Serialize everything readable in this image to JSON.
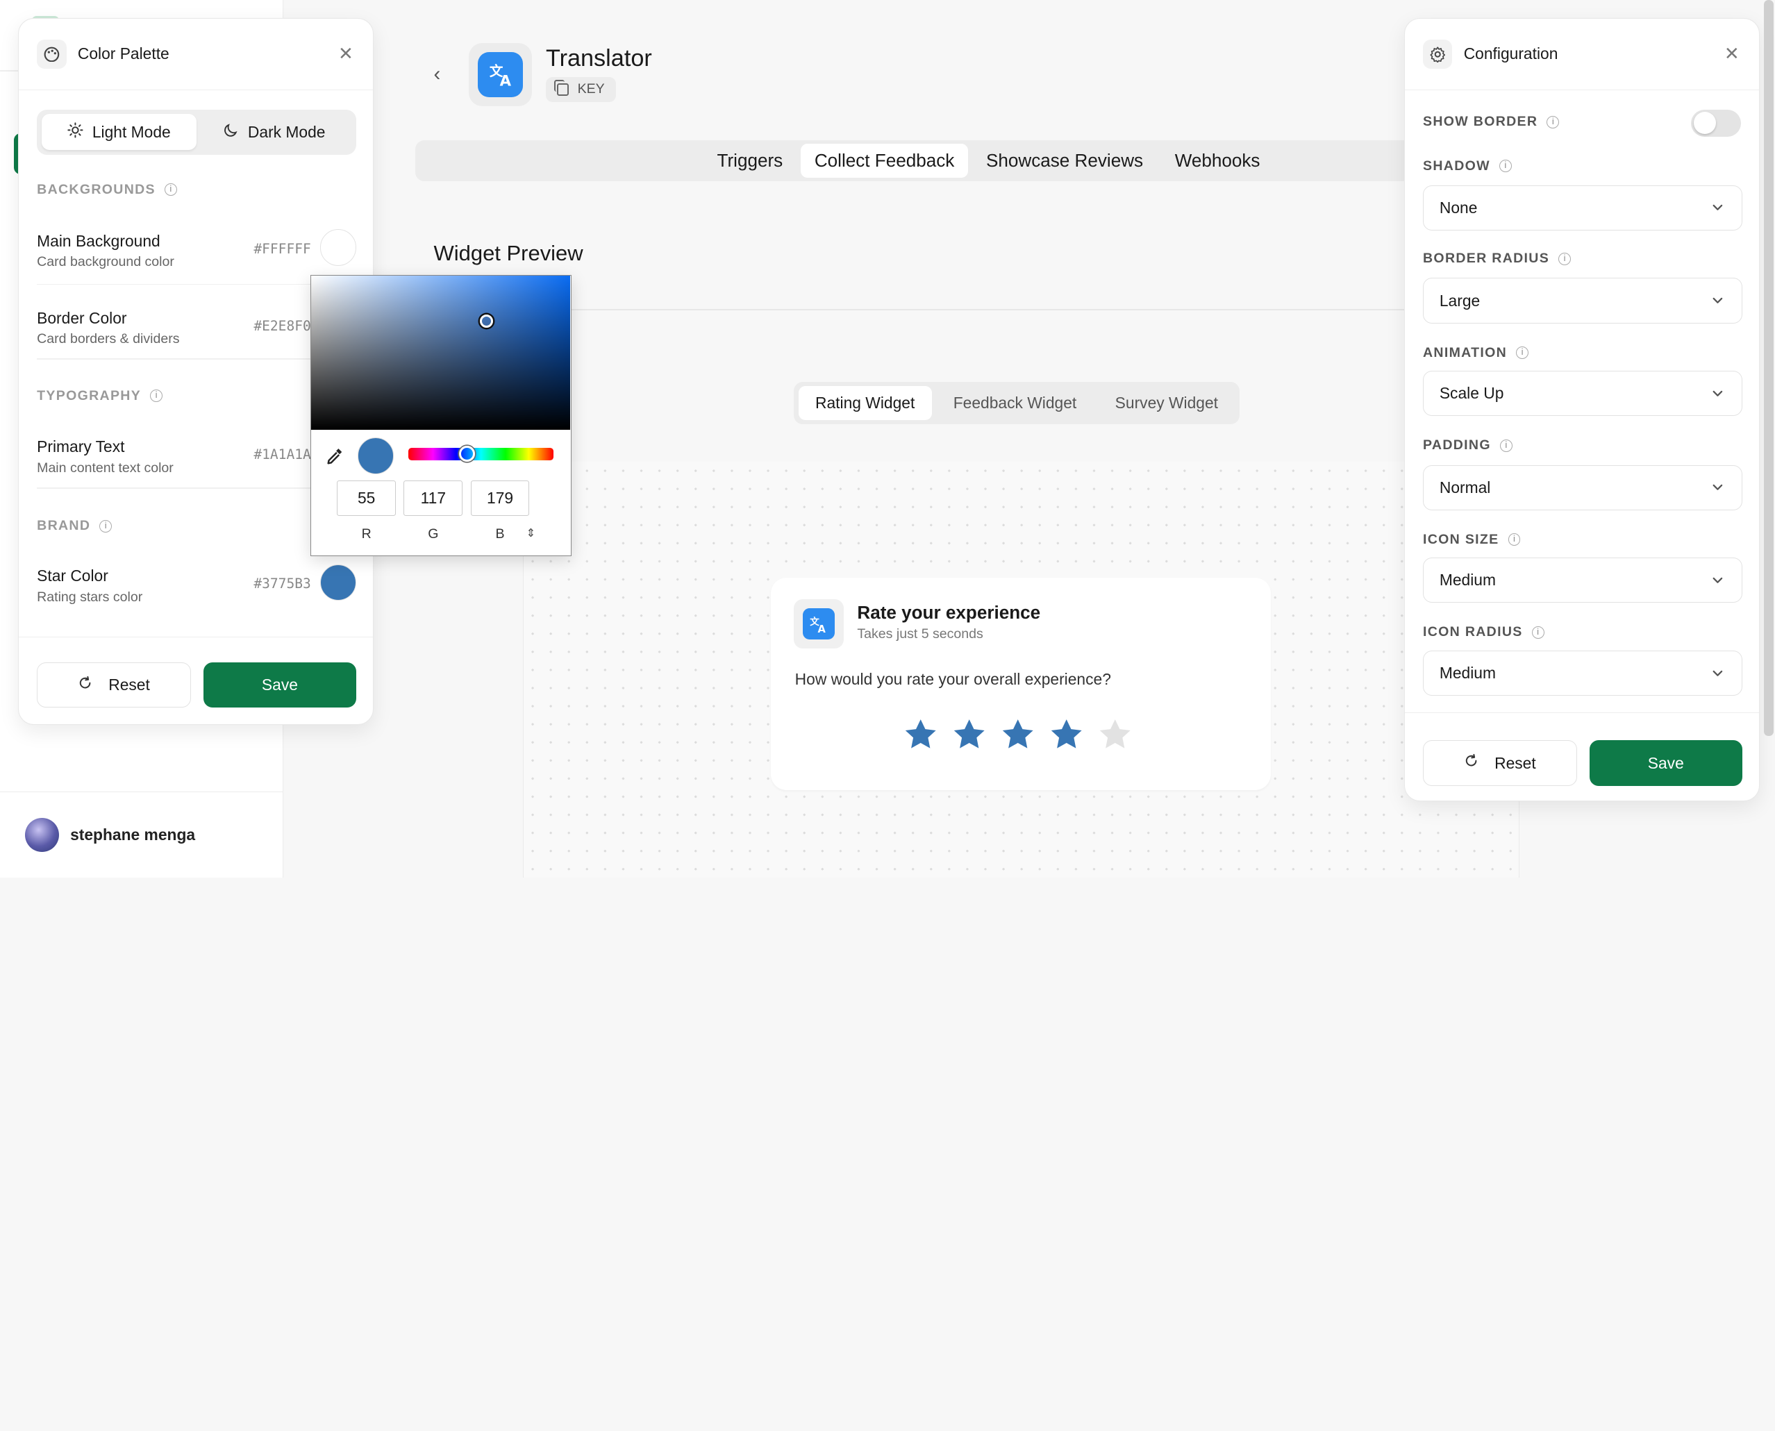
{
  "sidebar": {
    "user_name": "stephane menga"
  },
  "header": {
    "back_label": "‹",
    "app_name": "Translator",
    "key_label": "KEY"
  },
  "tabs": [
    "Triggers",
    "Collect Feedback",
    "Showcase Reviews",
    "Webhooks"
  ],
  "active_tab": "Collect Feedback",
  "preview": {
    "title": "Widget Preview",
    "widget_tabs": [
      "Rating Widget",
      "Feedback Widget",
      "Survey Widget"
    ],
    "active_widget_tab": "Rating Widget",
    "card": {
      "title": "Rate your experience",
      "subtitle": "Takes just 5 seconds",
      "question": "How would you rate your overall experience?",
      "rating": 4,
      "max_rating": 5,
      "star_color": "#3775B3",
      "empty_star_color": "#E2E2E2"
    }
  },
  "palette": {
    "title": "Color Palette",
    "modes": [
      "Light Mode",
      "Dark Mode"
    ],
    "active_mode": "Light Mode",
    "groups": {
      "backgrounds": "BACKGROUNDS",
      "typography": "TYPOGRAPHY",
      "brand": "BRAND"
    },
    "rows": {
      "main_bg": {
        "name": "Main Background",
        "desc": "Card background color",
        "hex": "#FFFFFF",
        "color": "#FFFFFF"
      },
      "border": {
        "name": "Border Color",
        "desc": "Card borders & dividers",
        "hex": "#E2E8F0",
        "color": "#E2E8F0"
      },
      "primary_text": {
        "name": "Primary Text",
        "desc": "Main content text color",
        "hex": "#1A1A1A",
        "color": "#1A1A1A"
      },
      "star": {
        "name": "Star Color",
        "desc": "Rating stars color",
        "hex": "#3775B3",
        "color": "#3775B3"
      }
    },
    "reset_label": "Reset",
    "save_label": "Save"
  },
  "picker": {
    "r": "55",
    "g": "117",
    "b": "179",
    "r_label": "R",
    "g_label": "G",
    "b_label": "B",
    "current_color": "#3775B3"
  },
  "config": {
    "title": "Configuration",
    "show_border_label": "SHOW BORDER",
    "show_border": false,
    "shadow_label": "SHADOW",
    "shadow_value": "None",
    "border_radius_label": "BORDER RADIUS",
    "border_radius_value": "Large",
    "animation_label": "ANIMATION",
    "animation_value": "Scale Up",
    "padding_label": "PADDING",
    "padding_value": "Normal",
    "icon_size_label": "ICON SIZE",
    "icon_size_value": "Medium",
    "icon_radius_label": "ICON RADIUS",
    "icon_radius_value": "Medium",
    "reset_label": "Reset",
    "save_label": "Save"
  },
  "colors": {
    "brand_green": "#0E7A48",
    "app_blue": "#2D8CF0"
  }
}
